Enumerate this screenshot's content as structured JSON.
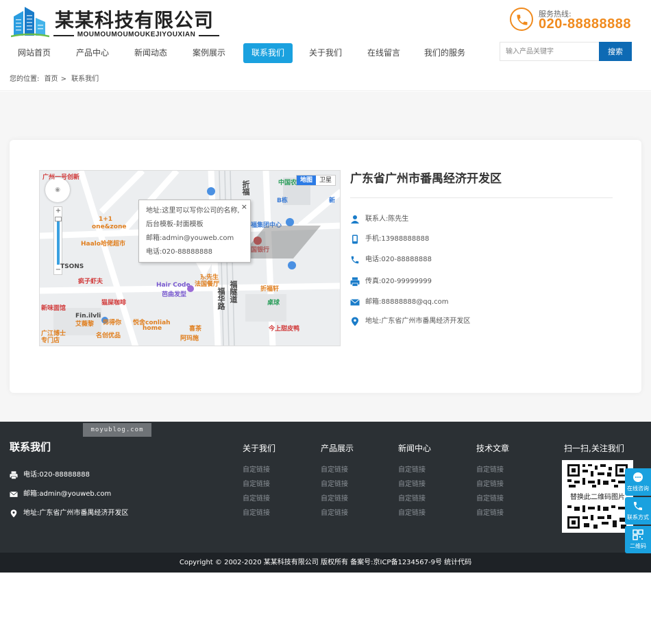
{
  "header": {
    "logo_title": "某某科技有限公司",
    "logo_subtitle": "MOUMOUMOUMOUKEJIYOUXIAN",
    "hotline_label": "服务热线:",
    "hotline_number": "020-88888888"
  },
  "nav": {
    "items": [
      {
        "label": "网站首页"
      },
      {
        "label": "产品中心"
      },
      {
        "label": "新闻动态"
      },
      {
        "label": "案例展示"
      },
      {
        "label": "联系我们",
        "active": true
      },
      {
        "label": "关于我们"
      },
      {
        "label": "在线留言"
      },
      {
        "label": "我们的服务"
      }
    ]
  },
  "search": {
    "placeholder": "输入产品关键字",
    "button_label": "搜索"
  },
  "breadcrumb": {
    "prefix": "您的位置:",
    "home": "首页",
    "separator": ">",
    "current": "联系我们"
  },
  "map": {
    "type_map": "地图",
    "type_satellite": "卫星",
    "popup": {
      "address": "地址:这里可以写你公司的名称,后台模板-封面模板",
      "email": "邮箱:admin@youweb.com",
      "phone": "电话:020-88888888",
      "close": "×"
    },
    "labels": {
      "l1": "广州一号创新",
      "l2": "1+1",
      "l3": "one&zone",
      "l4": "Haalo哈佬超市",
      "l5": "TSONS",
      "l6": "疯子虾夫",
      "l7": "Hair Code",
      "l8": "芭曲发型",
      "l9": "猫屎咖啡",
      "l10": "Fin.ilvli",
      "l11": "艾薇黎",
      "l12": "饰得你",
      "l13": "悦舍conliah",
      "l14": "home",
      "l15": "名创优品",
      "l16": "阿玛施",
      "l17": "喜茶",
      "l18": "今上甜皮鸭",
      "l19": "桌球",
      "l20": "折福轩",
      "l21": "福集团中心",
      "l22": "国银行",
      "l23": "福华路",
      "l24": "福华路",
      "l25": "折福",
      "l26": "新",
      "l27": "B栋",
      "l28": "中国农",
      "l29": "福隧道",
      "l30": "新味面馆",
      "l31": "广江博士",
      "l32": "专门店",
      "l33": "东先生",
      "l34": "法国餐厅"
    }
  },
  "contact": {
    "title": "广东省广州市番禺经济开发区",
    "person": "联系人:陈先生",
    "mobile": "手机:13988888888",
    "phone": "电话:020-88888888",
    "fax": "传真:020-99999999",
    "email": "邮箱:88888888@qq.com",
    "address": "地址:广东省广州市番禺经济开发区"
  },
  "footer": {
    "watermark": "moyublog.com",
    "title": "联系我们",
    "phone": "电话:020-88888888",
    "email": "邮箱:admin@youweb.com",
    "address": "地址:广东省广州市番禺经济开发区",
    "columns": [
      {
        "title": "关于我们",
        "links": [
          "自定链接",
          "自定链接",
          "自定链接",
          "自定链接"
        ]
      },
      {
        "title": "产品展示",
        "links": [
          "自定链接",
          "自定链接",
          "自定链接",
          "自定链接"
        ]
      },
      {
        "title": "新闻中心",
        "links": [
          "自定链接",
          "自定链接",
          "自定链接",
          "自定链接"
        ]
      },
      {
        "title": "技术文章",
        "links": [
          "自定链接",
          "自定链接",
          "自定链接",
          "自定链接"
        ]
      }
    ],
    "qr_title": "扫一扫,关注我们",
    "qr_text": "替换此二维码图片",
    "copyright": "Copyright © 2002-2020 某某科技有限公司 版权所有    备案号:京ICP备1234567-9号 统计代码"
  },
  "float": {
    "consult": "在线咨询",
    "contact": "联系方式",
    "qrcode": "二维码"
  },
  "colors": {
    "accent": "#1aa1df",
    "hotline": "#f08a1d",
    "search_button": "#0d6ab4",
    "footer_bg": "#2b3034"
  }
}
